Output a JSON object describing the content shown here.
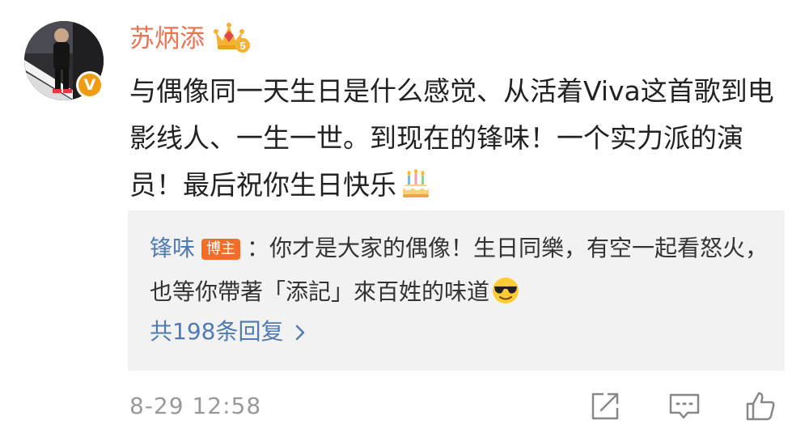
{
  "comment": {
    "username": "苏炳添",
    "vip_level": "5",
    "verified_mark": "V",
    "text": "与偶像同一天生日是什么感觉、从活着Viva这首歌到电影线人、一生一世。到现在的锋味！一个实力派的演员！最后祝你生日快乐",
    "text_emoji": "birthday-cake",
    "timestamp": "8-29 12:58"
  },
  "reply": {
    "name": "锋味",
    "badge": "博主",
    "text": "：你才是大家的偶像！生日同樂，有空一起看怒火，也等你帶著「添記」來百姓的味道",
    "text_emoji": "sunglasses-face",
    "more_label": "共198条回复"
  },
  "actions": {
    "icons": [
      "share-icon",
      "comment-icon",
      "like-icon"
    ]
  },
  "colors": {
    "username": "#eb7350",
    "link": "#4f7bb2",
    "badge": "#f26d2a",
    "verified": "#f09c13",
    "reply_bg": "#f2f2f2",
    "meta": "#999999"
  }
}
